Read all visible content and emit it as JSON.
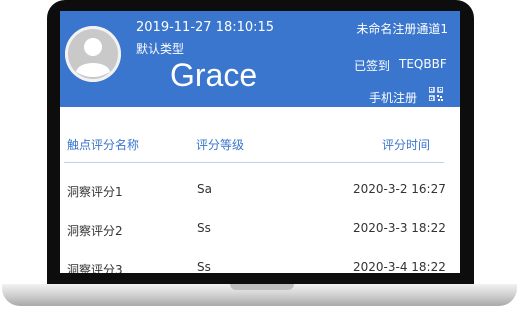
{
  "header": {
    "datetime": "2019-11-27 18:10:15",
    "type": "默认类型",
    "name": "Grace",
    "channel": "未命名注册通道1",
    "sign_status": "已签到",
    "code": "TEQBBF",
    "register_label": "手机注册"
  },
  "table": {
    "columns": [
      "触点评分名称",
      "评分等级",
      "评分时间"
    ],
    "rows": [
      {
        "name": "洞察评分1",
        "grade": "Sa",
        "time": "2020-3-2 16:27"
      },
      {
        "name": "洞察评分2",
        "grade": "Ss",
        "time": "2020-3-3 18:22"
      },
      {
        "name": "洞察评分3",
        "grade": "Ss",
        "time": "2020-3-4 18:22"
      }
    ]
  },
  "colors": {
    "header_bg": "#3a76cd",
    "accent": "#3a76cd"
  }
}
